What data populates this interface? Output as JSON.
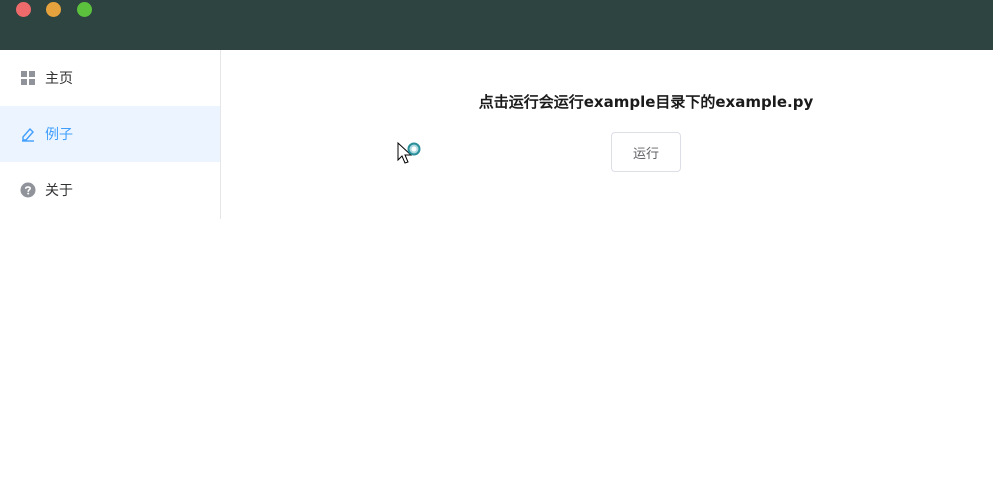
{
  "window": {
    "controls": [
      "close",
      "minimize",
      "maximize"
    ]
  },
  "sidebar": {
    "items": [
      {
        "label": "主页",
        "icon": "grid-icon",
        "active": false
      },
      {
        "label": "例子",
        "icon": "edit-icon",
        "active": true
      },
      {
        "label": "关于",
        "icon": "question-icon",
        "active": false
      }
    ]
  },
  "main": {
    "heading": "点击运行会运行example目录下的example.py",
    "run_button_label": "运行"
  },
  "colors": {
    "titlebar": "#2e4441",
    "active_bg": "#ecf5ff",
    "active_text": "#409eff",
    "close": "#ef6a6a",
    "minimize": "#e6a23c",
    "maximize": "#5cc13d"
  }
}
